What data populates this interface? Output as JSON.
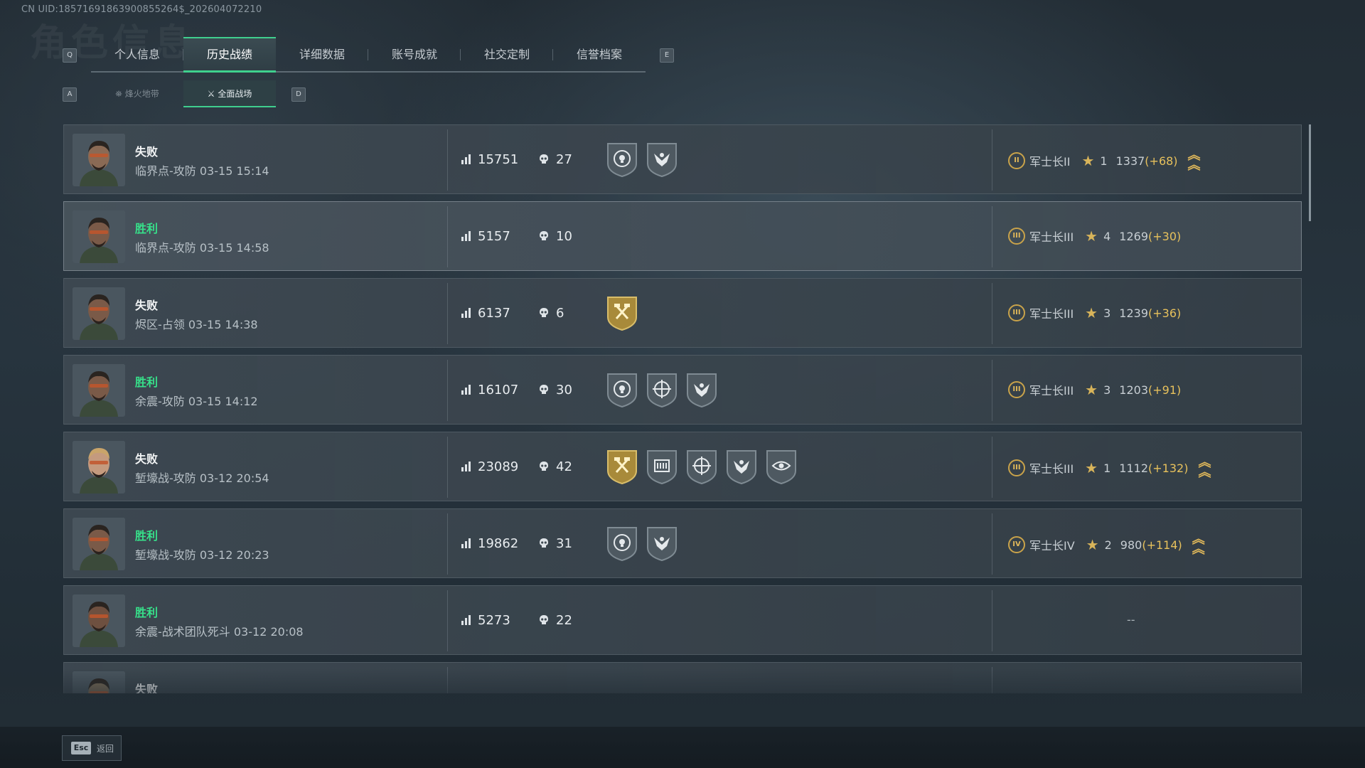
{
  "header": {
    "uid": "CN UID:18571691863900855264$_202604072210",
    "title_watermark": "角色信息"
  },
  "keys": {
    "prev_tab": "Q",
    "next_tab": "E",
    "prev_sub": "A",
    "next_sub": "D"
  },
  "tabs": [
    {
      "label": "个人信息"
    },
    {
      "label": "历史战绩"
    },
    {
      "label": "详细数据"
    },
    {
      "label": "账号成就"
    },
    {
      "label": "社交定制"
    },
    {
      "label": "信誉档案"
    }
  ],
  "subtabs": [
    {
      "label": "烽火地带"
    },
    {
      "label": "全面战场"
    }
  ],
  "matches": [
    {
      "result": "失败",
      "win": false,
      "map": "临界点-攻防",
      "time": "03-15 15:14",
      "score": "15751",
      "kills": "27",
      "badges": [
        "skull-target",
        "eagle"
      ],
      "rank_roman": "II",
      "rank": "军士长II",
      "stars": "1",
      "points": "1337",
      "delta": "(+68)",
      "promo": true
    },
    {
      "result": "胜利",
      "win": true,
      "map": "临界点-攻防",
      "time": "03-15 14:58",
      "score": "5157",
      "kills": "10",
      "badges": [],
      "rank_roman": "III",
      "rank": "军士长III",
      "stars": "4",
      "points": "1269",
      "delta": "(+30)",
      "promo": false
    },
    {
      "result": "失败",
      "win": false,
      "map": "烬区-占领",
      "time": "03-15 14:38",
      "score": "6137",
      "kills": "6",
      "badges": [
        "gold-hammers"
      ],
      "rank_roman": "III",
      "rank": "军士长III",
      "stars": "3",
      "points": "1239",
      "delta": "(+36)",
      "promo": false
    },
    {
      "result": "胜利",
      "win": true,
      "map": "余震-攻防",
      "time": "03-15 14:12",
      "score": "16107",
      "kills": "30",
      "badges": [
        "skull-target",
        "crosshair",
        "eagle"
      ],
      "rank_roman": "III",
      "rank": "军士长III",
      "stars": "3",
      "points": "1203",
      "delta": "(+91)",
      "promo": false
    },
    {
      "result": "失败",
      "win": false,
      "map": "堑壕战-攻防",
      "time": "03-12 20:54",
      "score": "23089",
      "kills": "42",
      "badges": [
        "gold-hammers",
        "crate",
        "crosshair",
        "eagle",
        "eye"
      ],
      "rank_roman": "III",
      "rank": "军士长III",
      "stars": "1",
      "points": "1112",
      "delta": "(+132)",
      "promo": true
    },
    {
      "result": "胜利",
      "win": true,
      "map": "堑壕战-攻防",
      "time": "03-12 20:23",
      "score": "19862",
      "kills": "31",
      "badges": [
        "skull-target",
        "eagle"
      ],
      "rank_roman": "IV",
      "rank": "军士长IV",
      "stars": "2",
      "points": "980",
      "delta": "(+114)",
      "promo": true
    },
    {
      "result": "胜利",
      "win": true,
      "map": "余震-战术团队死斗",
      "time": "03-12 20:08",
      "score": "5273",
      "kills": "22",
      "badges": [],
      "no_rank": "--"
    },
    {
      "result": "失败",
      "win": false,
      "map": "",
      "time": "",
      "score": "",
      "kills": "",
      "badges": []
    }
  ],
  "footer": {
    "esc_key": "Esc",
    "back_label": "返回"
  },
  "colors": {
    "accent": "#3fcf8e",
    "win": "#37e08a",
    "gold": "#e7c15c"
  }
}
